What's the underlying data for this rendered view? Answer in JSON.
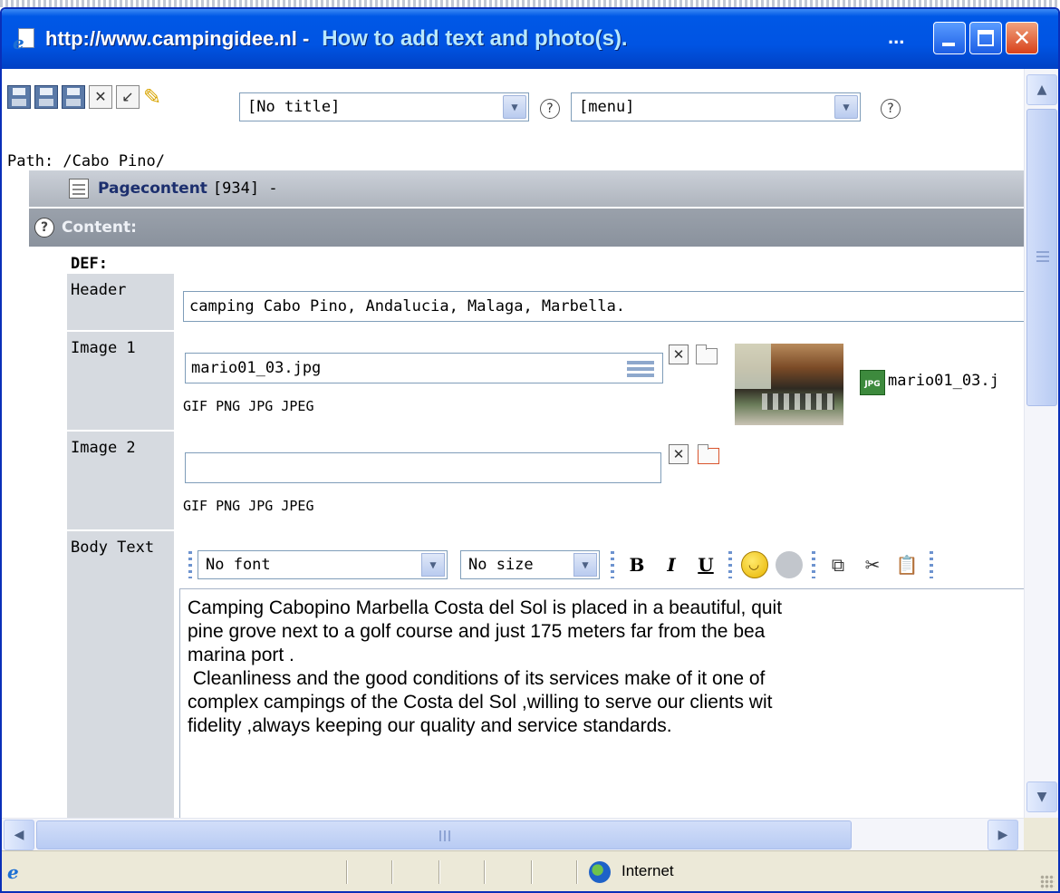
{
  "titlebar": {
    "url": "http://www.campingidee.nl -",
    "title": "How to add text and photo(s).",
    "ellipsis": "..."
  },
  "toolbar": {
    "title_select": "[No title]",
    "menu_select": "[menu]",
    "help_glyph": "?"
  },
  "path": "Path: /Cabo Pino/",
  "pagecontent": {
    "label": "Pagecontent",
    "id": "[934] -"
  },
  "content_section": {
    "label": "Content:"
  },
  "form": {
    "def_label": "DEF:",
    "header": {
      "label": "Header",
      "value": "camping Cabo Pino, Andalucia, Malaga, Marbella."
    },
    "image1": {
      "label": "Image 1",
      "value": "mario01_03.jpg",
      "types": "GIF PNG JPG JPEG",
      "file_link": "mario01_03.j",
      "file_badge": "JPG"
    },
    "image2": {
      "label": "Image 2",
      "value": "",
      "types": "GIF PNG JPG JPEG"
    },
    "body_text": {
      "label": "Body Text",
      "font_select": "No font",
      "size_select": "No size",
      "bold": "B",
      "italic": "I",
      "underline": "U",
      "lines": [
        "Camping Cabopino Marbella Costa del Sol is placed in a beautiful, quit",
        "pine grove next to a golf course and just 175 meters far from the bea",
        "marina port .",
        "",
        " Cleanliness and the good conditions of its services make of it one of",
        "complex campings of the Costa del Sol ,willing to serve our clients wit",
        "fidelity ,always keeping our quality and service standards."
      ]
    }
  },
  "statusbar": {
    "zone": "Internet"
  },
  "colors": {
    "titlebar": "#0054e3",
    "section_bar": "#aeb4bd",
    "content_bar": "#8a929d",
    "label_column": "#d6dae0",
    "pagecontent_text": "#1c2f6e"
  },
  "icons": [
    "ie-icon",
    "minimize-icon",
    "maximize-icon",
    "close-icon",
    "save-icon",
    "save-view-icon",
    "save-close-icon",
    "close-doc-icon",
    "undo-icon",
    "pencil-icon",
    "help-icon",
    "document-icon",
    "delete-icon",
    "folder-icon",
    "browse-icon",
    "jpg-file-icon",
    "smiley-icon",
    "link-icon",
    "copy-icon",
    "cut-icon",
    "paste-icon",
    "globe-icon"
  ]
}
